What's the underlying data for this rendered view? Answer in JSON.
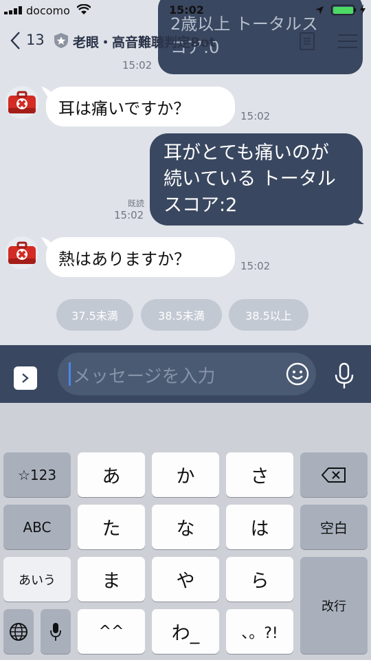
{
  "status": {
    "carrier": "docomo",
    "time": "15:02"
  },
  "header": {
    "back_count": "13",
    "title": "老眼・高音難聴判定Bot"
  },
  "messages": {
    "prev_out_text": "2歳以上 トータルス\nコア:0",
    "prev_out_time": "15:02",
    "m1_text": "耳は痛いですか？",
    "m1_time": "15:02",
    "m2_line1": "耳がとても痛いのが",
    "m2_line2": "続いている トータル",
    "m2_line3": "スコア:2",
    "m2_read": "既読",
    "m2_time": "15:02",
    "m3_text": "熱はありますか？",
    "m3_time": "15:02"
  },
  "quick_replies": [
    "37.5未満",
    "38.5未満",
    "38.5以上"
  ],
  "input": {
    "placeholder": "メッセージを入力"
  },
  "keyboard": {
    "k_num": "☆123",
    "k_a": "あ",
    "k_ka": "か",
    "k_sa": "さ",
    "k_abc": "ABC",
    "k_ta": "た",
    "k_na": "な",
    "k_ha": "は",
    "k_space": "空白",
    "k_aiu": "あいう",
    "k_ma": "ま",
    "k_ya": "や",
    "k_ra": "ら",
    "k_enter": "改行",
    "k_caret": "^^",
    "k_wa": "わ_",
    "k_punct": "、。?!"
  },
  "colors": {
    "accent_navy": "#394760",
    "chat_bg": "#dfe3e9",
    "battery": "#4cd964"
  },
  "icons": [
    "signal-icon",
    "wifi-icon",
    "location-icon",
    "battery-icon",
    "charging-icon",
    "back-chevron-icon",
    "shield-badge-icon",
    "notes-icon",
    "menu-icon",
    "bot-avatar-icon",
    "expand-arrow-icon",
    "emoji-icon",
    "microphone-icon",
    "delete-icon",
    "globe-icon",
    "keyboard-mic-icon"
  ]
}
